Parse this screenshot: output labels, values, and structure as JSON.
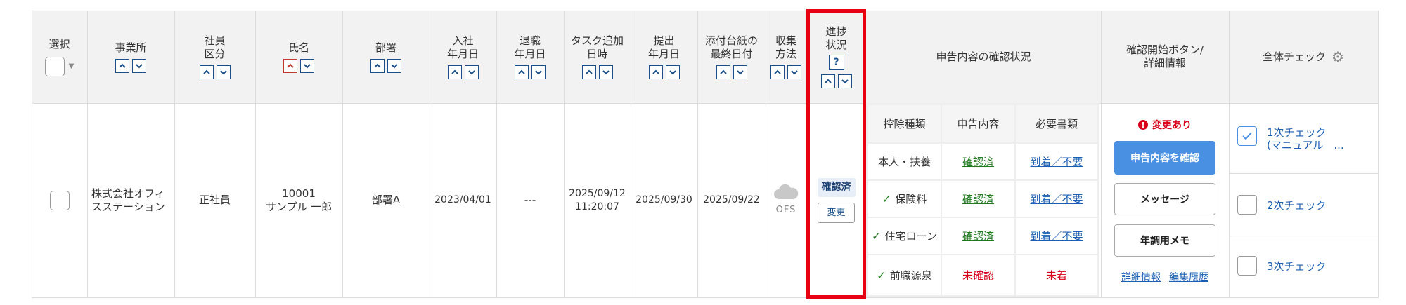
{
  "columns": {
    "select": "選択",
    "office": "事業所",
    "employee_type": "社員\n区分",
    "name": "氏名",
    "department": "部署",
    "join_date": "入社\n年月日",
    "leave_date": "退職\n年月日",
    "task_added": "タスク追加\n日時",
    "submitted": "提出\n年月日",
    "attachment_date": "添付台紙の\n最終日付",
    "collection": "収集\n方法",
    "progress": "進捗\n状況",
    "progress_help": "?",
    "declaration_status": "申告内容の確認状況",
    "confirm_start": "確認開始ボタン/\n詳細情報",
    "overall_check": "全体チェック"
  },
  "row": {
    "office": "株式会社オフィスステーション",
    "employee_type": "正社員",
    "employee_id": "10001",
    "employee_name": "サンプル 一郎",
    "department": "部署A",
    "join_date": "2023/04/01",
    "leave_date": "---",
    "task_added_date": "2025/09/12",
    "task_added_time": "11:20:07",
    "submitted": "2025/09/30",
    "attachment_date": "2025/09/22",
    "collection": "OFS",
    "progress_status": "確認済",
    "progress_change": "変更"
  },
  "declaration_table": {
    "headers": [
      "控除種類",
      "申告内容",
      "必要書類"
    ],
    "rows": [
      {
        "type": "本人・扶養",
        "check": false,
        "content": "確認済",
        "content_state": "ok",
        "docs": "到着／不要",
        "docs_state": "ok"
      },
      {
        "type": "保険料",
        "check": true,
        "content": "確認済",
        "content_state": "ok",
        "docs": "到着／不要",
        "docs_state": "ok"
      },
      {
        "type": "住宅ローン",
        "check": true,
        "content": "確認済",
        "content_state": "ok",
        "docs": "到着／不要",
        "docs_state": "ok"
      },
      {
        "type": "前職源泉",
        "check": true,
        "content": "未確認",
        "content_state": "ng",
        "docs": "未着",
        "docs_state": "ng"
      }
    ]
  },
  "actions": {
    "change_notice": "変更あり",
    "confirm_button": "申告内容を確認",
    "message_button": "メッセージ",
    "memo_button": "年調用メモ",
    "detail_link": "詳細情報",
    "history_link": "編集履歴"
  },
  "checks": [
    {
      "label": "1次チェック\n(マニュアル　...",
      "checked": true
    },
    {
      "label": "2次チェック",
      "checked": false
    },
    {
      "label": "3次チェック",
      "checked": false
    }
  ],
  "colors": {
    "accent_blue": "#4a90e2",
    "sort_blue": "#1a4f8a",
    "highlight_red": "#e60012",
    "ok_green": "#1f7a1f",
    "ng_red": "#d9001b"
  }
}
